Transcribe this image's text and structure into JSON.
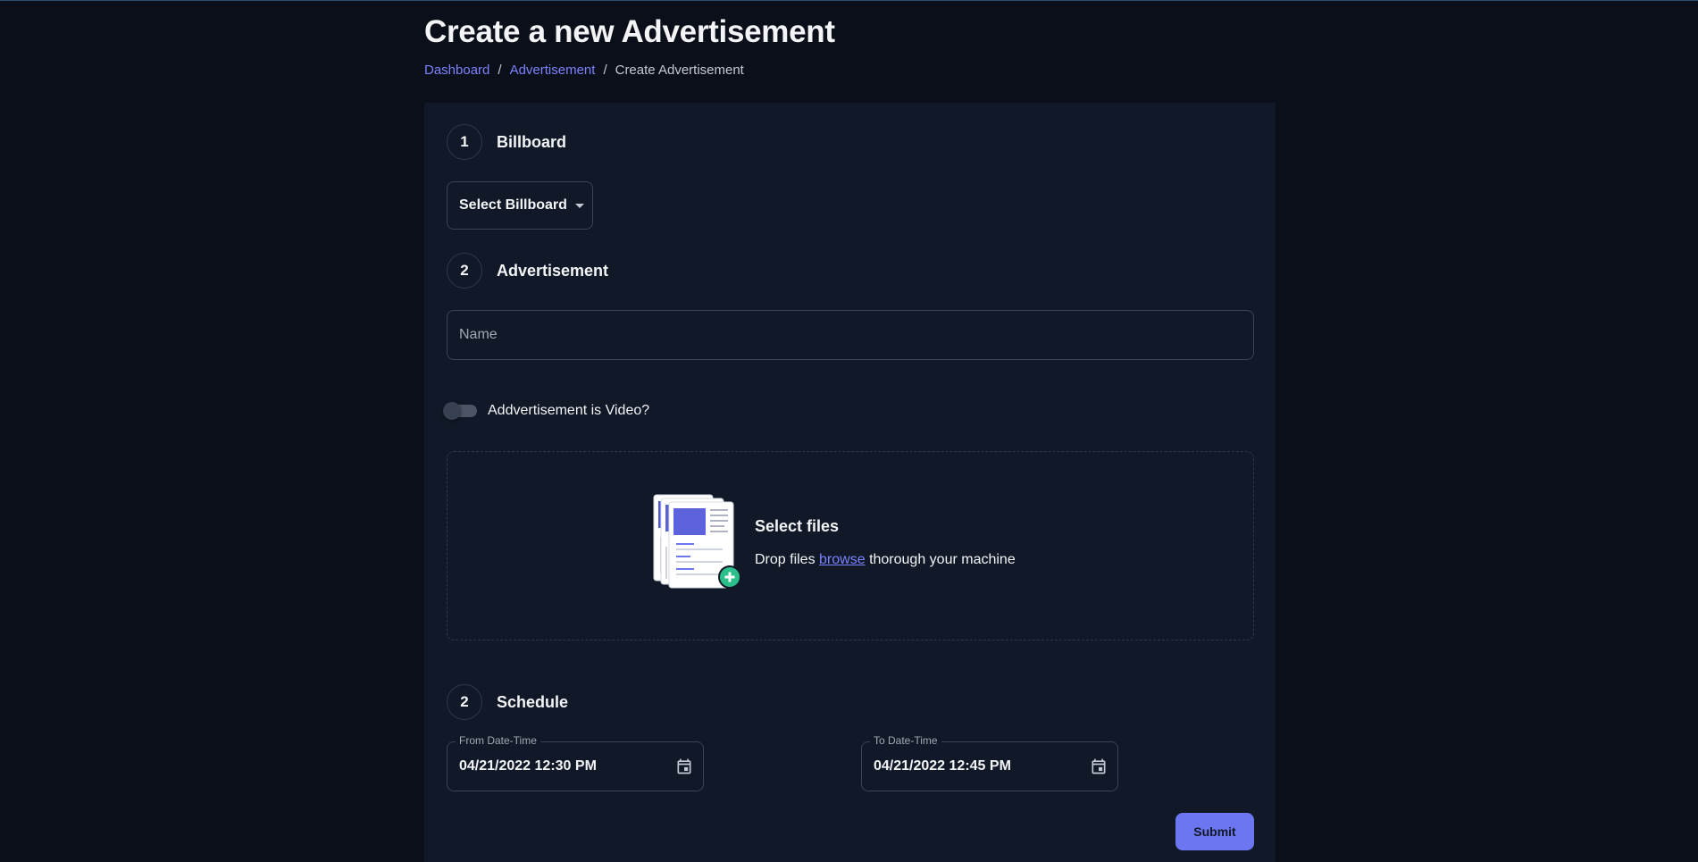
{
  "page": {
    "title": "Create a new Advertisement",
    "breadcrumb": [
      {
        "label": "Dashboard"
      },
      {
        "label": "Advertisement"
      },
      {
        "label": "Create Advertisement"
      }
    ],
    "breadcrumb_separator": "/"
  },
  "form": {
    "steps": [
      {
        "number": "1",
        "label": "Billboard"
      },
      {
        "number": "2",
        "label": "Advertisement"
      },
      {
        "number": "2",
        "label": "Schedule"
      }
    ],
    "billboard_select": {
      "label": "Select Billboard",
      "icon": "caret-down-icon"
    },
    "name_input": {
      "placeholder": "Name",
      "value": ""
    },
    "video_toggle": {
      "label": "Addvertisement is Video?",
      "checked": false
    },
    "dropzone": {
      "title": "Select files",
      "desc_before": "Drop files",
      "browse_label": "browse",
      "desc_after": "thorough your machine",
      "icon": "upload-files-illustration"
    },
    "from_date": {
      "label": "From Date-Time",
      "value": "04/21/2022 12:30 PM",
      "icon": "calendar-icon"
    },
    "to_date": {
      "label": "To Date-Time",
      "value": "04/21/2022 12:45 PM",
      "icon": "calendar-icon"
    },
    "submit_label": "Submit"
  },
  "colors": {
    "background": "#0b0f19",
    "card": "#111827",
    "accent": "#6b76f0",
    "link": "#7b83ff",
    "success": "#2bbf8a"
  }
}
